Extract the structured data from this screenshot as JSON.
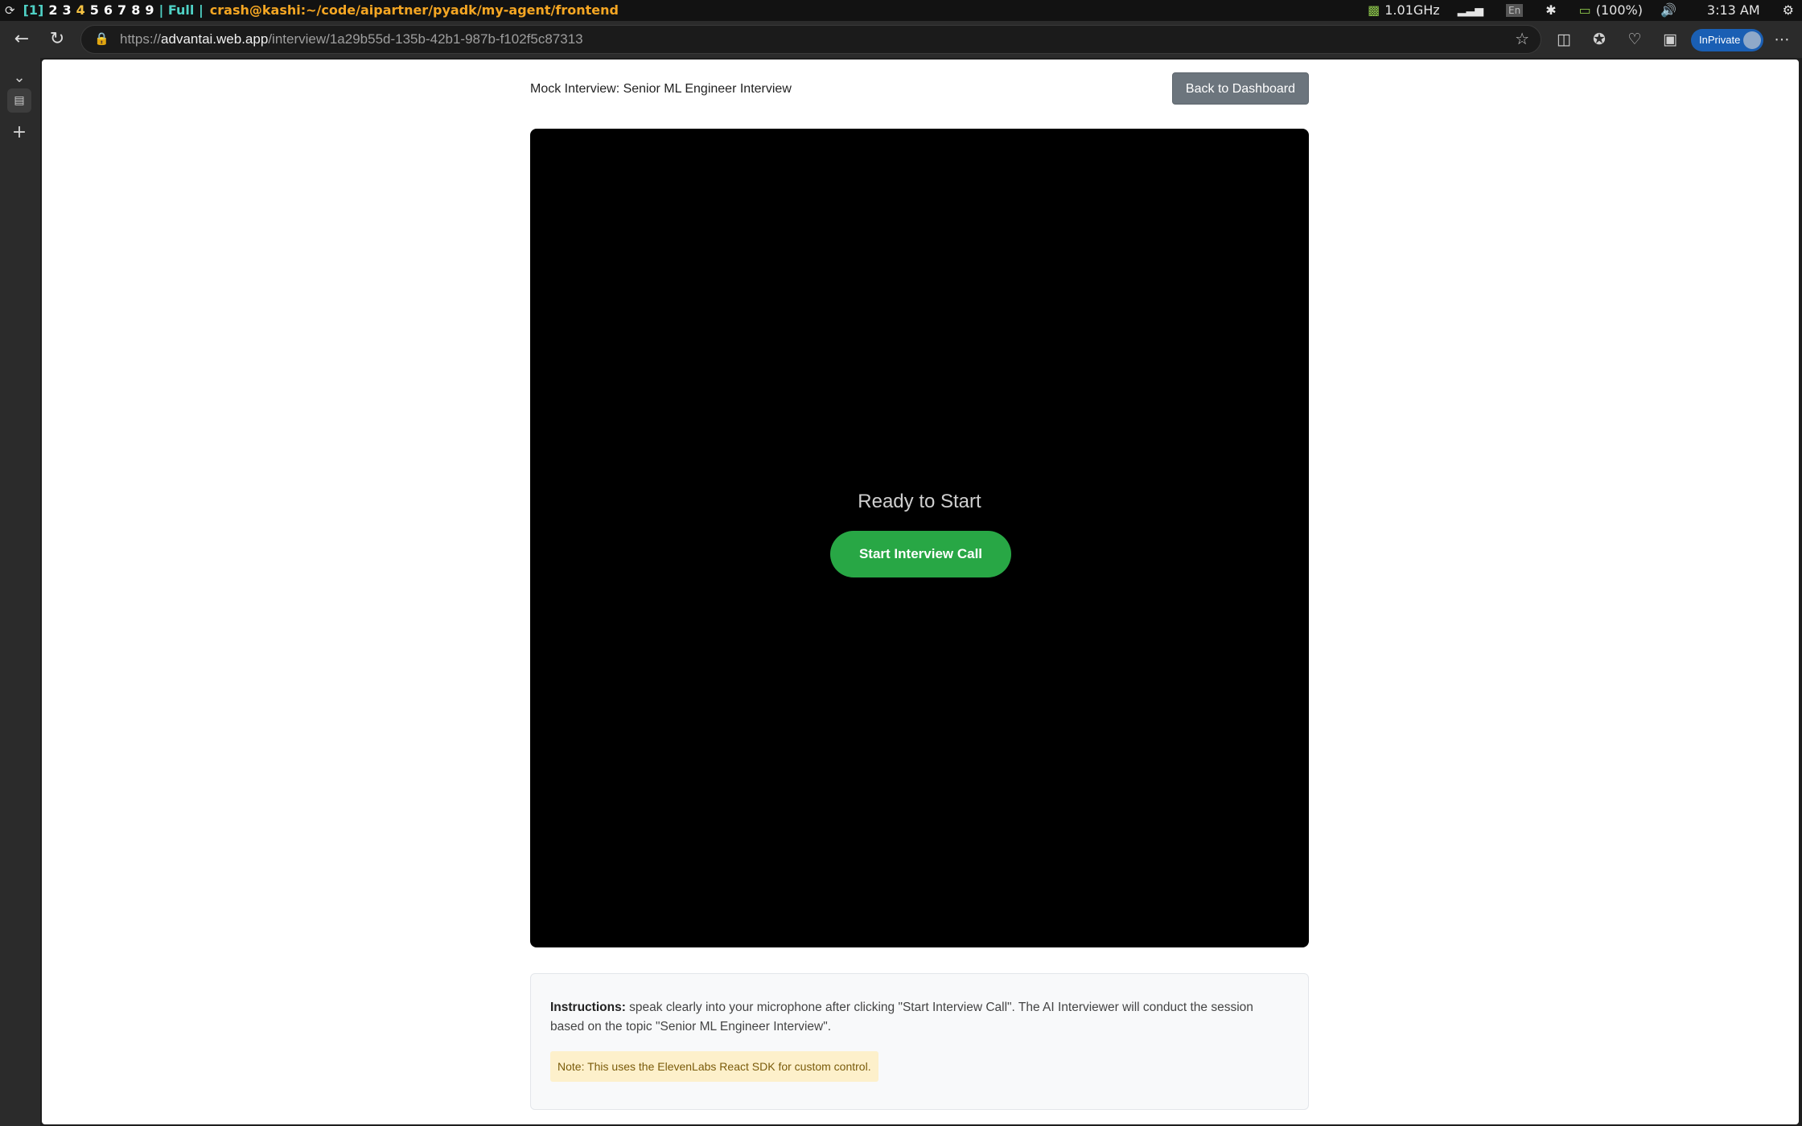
{
  "status_bar": {
    "workspace_current": "[1]",
    "workspaces": [
      "2",
      "3",
      "4",
      "5",
      "6",
      "7",
      "8",
      "9"
    ],
    "layout": "| Full |",
    "window_title": "crash@kashi:~/code/aipartner/pyadk/my-agent/frontend",
    "cpu_freq": "1.01GHz",
    "lang": "En",
    "battery": "(100%)",
    "time": "3:13 AM"
  },
  "browser": {
    "url_scheme": "https://",
    "url_host": "advantai.web.app",
    "url_path": "/interview/1a29b55d-135b-42b1-987b-f102f5c87313",
    "inprivate_label": "InPrivate"
  },
  "page": {
    "title": "Mock Interview: Senior ML Engineer Interview",
    "back_button": "Back to Dashboard",
    "status": "Ready to Start",
    "start_button": "Start Interview Call",
    "instructions_label": "Instructions:",
    "instructions_text": " speak clearly into your microphone after clicking \"Start Interview Call\". The AI Interviewer will conduct the session based on the topic \"Senior ML Engineer Interview\".",
    "note": "Note: This uses the ElevenLabs React SDK for custom control."
  },
  "colors": {
    "start_button": "#28a745",
    "back_button": "#6c757d",
    "note_bg": "#fdf0cb",
    "stage_bg": "#000000"
  }
}
